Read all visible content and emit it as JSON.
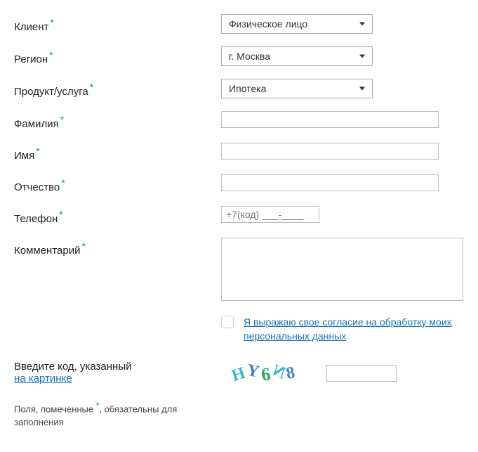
{
  "labels": {
    "client": "Клиент",
    "region": "Регион",
    "product": "Продукт/услуга",
    "lastname": "Фамилия",
    "firstname": "Имя",
    "patronymic": "Отчество",
    "phone": "Телефон",
    "comment": "Комментарий"
  },
  "selects": {
    "client": "Физическое лицо",
    "region": "г. Москва",
    "product": "Ипотека"
  },
  "phone_placeholder": "+7(код) ___-____",
  "consent": "Я выражаю свое согласие на обработку моих персональных данных",
  "captcha": {
    "line1": "Введите код, указанный",
    "line2": "на картинке",
    "code": "HY6N8"
  },
  "note": {
    "before": "Поля, помеченные ",
    "after": ", обязательны для заполнения"
  },
  "asterisk": "*"
}
